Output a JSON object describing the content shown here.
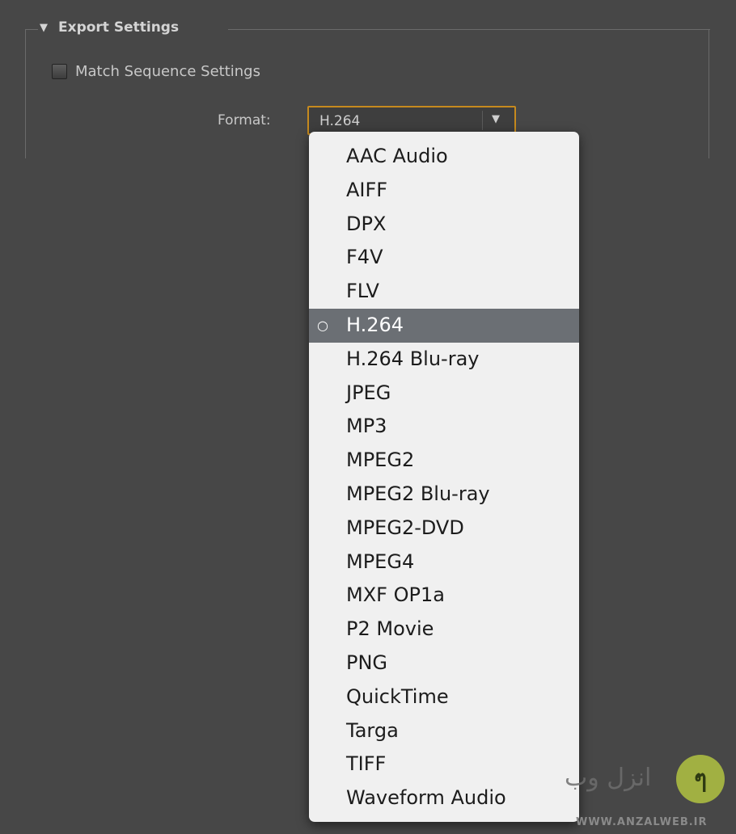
{
  "export_settings": {
    "title": "Export Settings",
    "match_sequence_label": "Match Sequence Settings",
    "format_label": "Format:",
    "format_value": "H.264"
  },
  "format_menu": {
    "items": [
      "AAC Audio",
      "AIFF",
      "DPX",
      "F4V",
      "FLV",
      "H.264",
      "H.264 Blu-ray",
      "JPEG",
      "MP3",
      "MPEG2",
      "MPEG2 Blu-ray",
      "MPEG2-DVD",
      "MPEG4",
      "MXF OP1a",
      "P2 Movie",
      "PNG",
      "QuickTime",
      "Targa",
      "TIFF",
      "Waveform Audio"
    ],
    "selected_marker": "○"
  },
  "icons": {
    "disclosure": "disclosure-triangle-icon",
    "dropdown": "dropdown-arrow-icon"
  },
  "colors": {
    "panel_bg": "#474747",
    "focus_border": "#c68a1e",
    "menu_bg": "#f0f0f0",
    "selected_bg": "#6b6f74"
  },
  "watermark": {
    "text": "انزل وب",
    "url": "WWW.ANZALWEB.IR"
  }
}
